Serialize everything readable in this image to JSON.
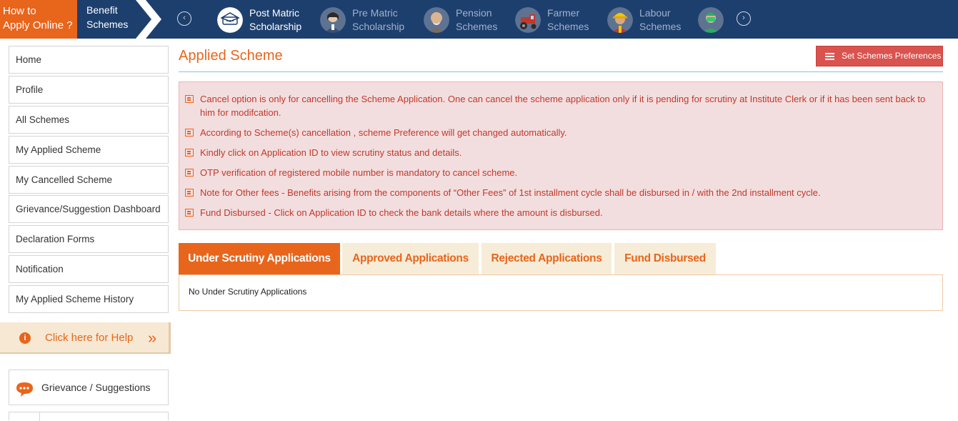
{
  "topbar": {
    "how_to_line1": "How to",
    "how_to_line2": "Apply Online ?",
    "benefit_line1": "Benefit",
    "benefit_line2": "Schemes",
    "prev_arrow": "‹",
    "next_arrow": "›",
    "schemes": [
      {
        "line1": "Post Matric",
        "line2": "Scholarship",
        "icon": "graduation-cap-icon",
        "active": true
      },
      {
        "line1": "Pre Matric",
        "line2": "Scholarship",
        "icon": "student-girl-icon",
        "active": false
      },
      {
        "line1": "Pension",
        "line2": "Schemes",
        "icon": "old-man-icon",
        "active": false
      },
      {
        "line1": "Farmer",
        "line2": "Schemes",
        "icon": "tractor-icon",
        "active": false
      },
      {
        "line1": "Labour",
        "line2": "Schemes",
        "icon": "worker-helmet-icon",
        "active": false
      },
      {
        "line1": "",
        "line2": "",
        "icon": "doctor-icon",
        "active": false
      }
    ]
  },
  "sidebar": {
    "items": [
      {
        "label": "Home"
      },
      {
        "label": "Profile"
      },
      {
        "label": "All Schemes"
      },
      {
        "label": "My Applied Scheme"
      },
      {
        "label": "My Cancelled Scheme"
      },
      {
        "label": "Grievance/Suggestion Dashboard"
      },
      {
        "label": "Declaration Forms"
      },
      {
        "label": "Notification"
      },
      {
        "label": "My Applied Scheme History"
      }
    ],
    "help_label": "Click here for Help",
    "help_arrow": "»",
    "grievance_label": "Grievance / Suggestions"
  },
  "main": {
    "title": "Applied Scheme",
    "preferences_button": "Set Schemes Preferences",
    "notes": [
      "Cancel option is only for cancelling the Scheme Application. One can cancel the scheme application only if it is pending for scrutiny at Institute Clerk or if it has been sent back to him for modifcation.",
      "According to Scheme(s) cancellation , scheme Preference will get changed automatically.",
      "Kindly click on Application ID to view scrutiny status and details.",
      "OTP verification of registered mobile number is mandatory to cancel scheme.",
      "Note for Other fees - Benefits arising from the components of “Other Fees” of 1st installment cycle shall be disbursed in / with the 2nd installment cycle.",
      "Fund Disbursed - Click on Application ID to check the bank details where the amount is disbursed."
    ],
    "tabs": [
      {
        "label": "Under Scrutiny Applications",
        "active": true
      },
      {
        "label": "Approved Applications",
        "active": false
      },
      {
        "label": "Rejected Applications",
        "active": false
      },
      {
        "label": "Fund Disbursed",
        "active": false
      }
    ],
    "tab_content": "No Under Scrutiny Applications"
  },
  "colors": {
    "navy": "#1d3f6e",
    "orange": "#e8651c",
    "alert_bg": "#f3dedf",
    "alert_text": "#c0392b",
    "button_red": "#d9534f",
    "tab_bg": "#f7ecd8"
  }
}
